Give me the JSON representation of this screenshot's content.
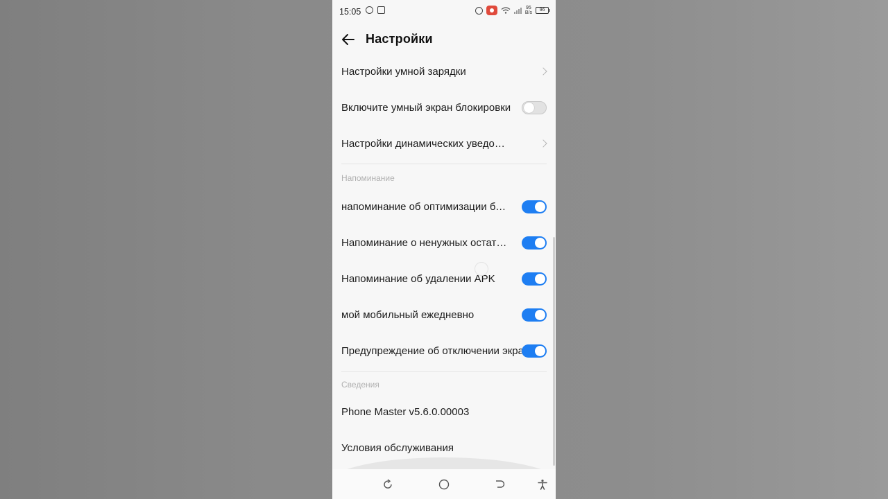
{
  "status_bar": {
    "time": "15:05",
    "net_speed_value": "95",
    "net_speed_unit": "B/s",
    "battery": "96"
  },
  "header": {
    "title": "Настройки"
  },
  "items": [
    {
      "label": "Настройки умной зарядки",
      "control": "chevron"
    },
    {
      "label": "Включите умный экран блокировки",
      "control": "toggle",
      "checked": false
    },
    {
      "label": "Настройки динамических уведомлений",
      "control": "chevron"
    }
  ],
  "section_reminder": {
    "title": "Напоминание",
    "items": [
      {
        "label": "напоминание об оптимизации батареи",
        "checked": true
      },
      {
        "label": "Напоминание о ненужных остатках",
        "checked": true
      },
      {
        "label": "Напоминание об удалении APK",
        "checked": true
      },
      {
        "label": "мой мобильный ежедневно",
        "checked": true
      },
      {
        "label": "Предупреждение об отключении экрана",
        "checked": true
      }
    ]
  },
  "section_info": {
    "title": "Сведения",
    "items": [
      {
        "label": "Phone Master v5.6.0.00003"
      },
      {
        "label": "Условия обслуживания"
      }
    ]
  },
  "colors": {
    "accent": "#1e7ef2",
    "record_badge": "#e04a3c",
    "background": "#f7f7f7"
  },
  "nav_icons": [
    "refresh-icon",
    "home-circle-icon",
    "back-return-icon",
    "accessibility-icon"
  ]
}
